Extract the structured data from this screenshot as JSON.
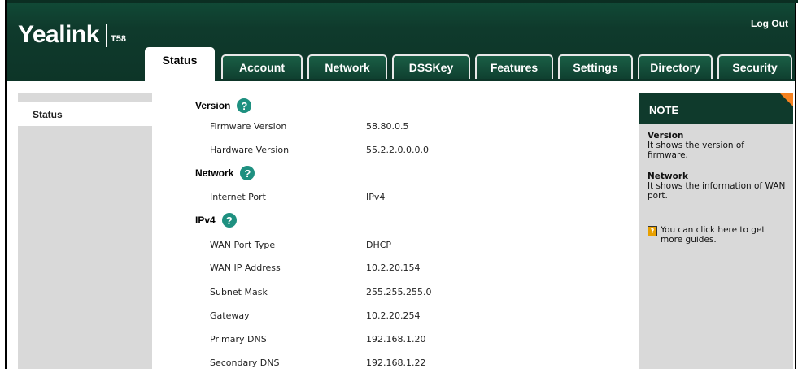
{
  "header": {
    "logo": "Yealink",
    "model": "T58",
    "logout_label": "Log Out",
    "tabs": [
      {
        "label": "Status",
        "active": true
      },
      {
        "label": "Account",
        "active": false
      },
      {
        "label": "Network",
        "active": false
      },
      {
        "label": "DSSKey",
        "active": false
      },
      {
        "label": "Features",
        "active": false
      },
      {
        "label": "Settings",
        "active": false
      },
      {
        "label": "Directory",
        "active": false
      },
      {
        "label": "Security",
        "active": false
      }
    ]
  },
  "sidebar": {
    "items": [
      {
        "label": "Status"
      }
    ]
  },
  "main": {
    "sections": {
      "version": {
        "title": "Version",
        "rows": [
          {
            "label": "Firmware Version",
            "value": "58.80.0.5"
          },
          {
            "label": "Hardware Version",
            "value": "55.2.2.0.0.0.0"
          }
        ]
      },
      "network": {
        "title": "Network",
        "rows": [
          {
            "label": "Internet Port",
            "value": "IPv4"
          }
        ]
      },
      "ipv4": {
        "title": "IPv4",
        "rows": [
          {
            "label": "WAN Port Type",
            "value": "DHCP"
          },
          {
            "label": "WAN IP Address",
            "value": "10.2.20.154"
          },
          {
            "label": "Subnet Mask",
            "value": "255.255.255.0"
          },
          {
            "label": "Gateway",
            "value": "10.2.20.254"
          },
          {
            "label": "Primary DNS",
            "value": "192.168.1.20"
          },
          {
            "label": "Secondary DNS",
            "value": "192.168.1.22"
          }
        ]
      }
    }
  },
  "note": {
    "title": "NOTE",
    "blocks": [
      {
        "title": "Version",
        "text": "It shows the version of firmware."
      },
      {
        "title": "Network",
        "text": "It shows the information of WAN port."
      }
    ],
    "guide_text": "You can click here to get more guides."
  },
  "colors": {
    "header_bg": "#0f3a2c",
    "accent": "#f58220",
    "help_icon": "#1e9080",
    "panel_gray": "#d9d9d9"
  },
  "icons": {
    "help": "question-circle-icon",
    "guide": "book-icon"
  }
}
